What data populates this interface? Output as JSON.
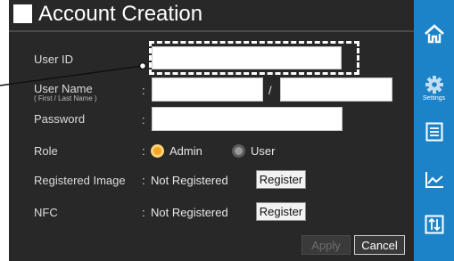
{
  "title": "Account Creation",
  "fields": {
    "user_id": {
      "label": "User ID",
      "value": ""
    },
    "user_name": {
      "label": "User Name",
      "sublabel": "( First / Last Name )",
      "separator": "/",
      "first": "",
      "last": ""
    },
    "password": {
      "label": "Password",
      "value": ""
    },
    "role": {
      "label": "Role",
      "options": [
        "Admin",
        "User"
      ],
      "selected": "Admin"
    },
    "registered_image": {
      "label": "Registered Image",
      "status": "Not Registered",
      "button": "Register"
    },
    "nfc": {
      "label": "NFC",
      "status": "Not Registered",
      "button": "Register"
    }
  },
  "colon": ":",
  "actions": {
    "apply": "Apply",
    "cancel": "Cancel"
  },
  "sidebar": [
    {
      "icon": "home-icon",
      "label": ""
    },
    {
      "icon": "gear-icon",
      "label": "Settings"
    },
    {
      "icon": "list-icon",
      "label": ""
    },
    {
      "icon": "chart-icon",
      "label": ""
    },
    {
      "icon": "transfer-icon",
      "label": ""
    }
  ],
  "colors": {
    "panel": "#282828",
    "sidebar": "#1d83c8",
    "radio_on": "#f5a623"
  }
}
